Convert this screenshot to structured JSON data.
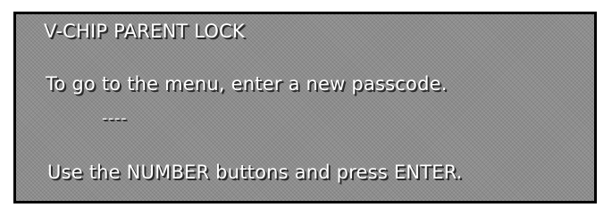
{
  "osd": {
    "title": "V-CHIP PARENT LOCK",
    "instruction": "To go to the menu, enter a new passcode.",
    "passcode_entry": "----",
    "help_text": "Use the NUMBER buttons and press ENTER."
  },
  "colors": {
    "panel_background": "#8e8e8e",
    "panel_border": "#000000",
    "text": "#ffffff"
  }
}
